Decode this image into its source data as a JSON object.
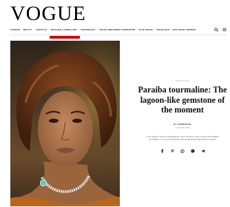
{
  "brand": {
    "logo_text": "VOGUE"
  },
  "nav": {
    "items": [
      {
        "label": "FASHION"
      },
      {
        "label": "BEAUTY"
      },
      {
        "label": "LIFESTYLE"
      },
      {
        "label": "WATCHES & JEWELLERY",
        "active": true
      },
      {
        "label": "TECHNOLOGY"
      },
      {
        "label": "VOGUE SINGAPORE FOUNDATION"
      },
      {
        "label": "CLUB VOGUE"
      },
      {
        "label": "VOGUE BAR"
      },
      {
        "label": "EXCLUSIVE CONTENT"
      }
    ],
    "active_color": "#d10000",
    "icons": [
      "search-icon",
      "menu-icon"
    ]
  },
  "article": {
    "kicker": "Jewellery",
    "headline": "Paraiba tourmaline: The lagoon-like gemstone of the moment",
    "byline": "BY GORDON NG",
    "date": "14 AUGUST 2024",
    "standfirst": "If you haven’t yet been acquainted, now’s the time to get to know the Paraiba tourmaline, one of the rarest and most hotly desired gemstones around",
    "image_credit": "Getty",
    "share_icons": [
      "facebook-icon",
      "x-twitter-icon",
      "whatsapp-icon",
      "messenger-icon",
      "telegram-icon"
    ]
  }
}
